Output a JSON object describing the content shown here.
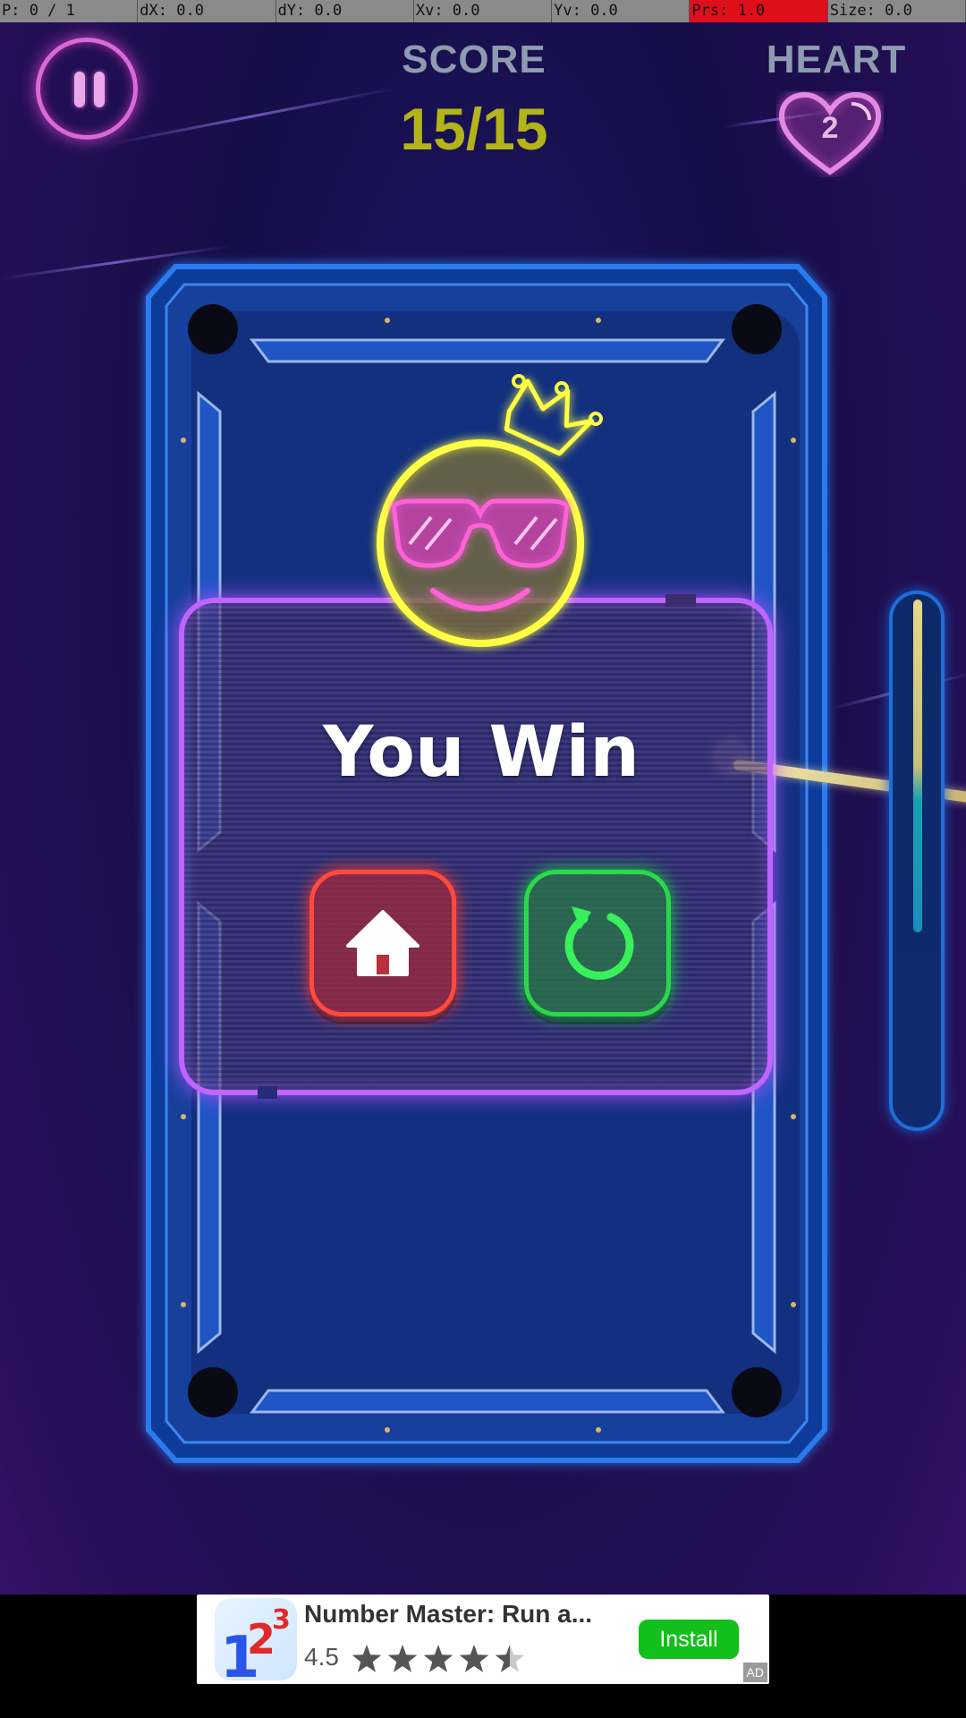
{
  "debug_bar": {
    "p": "P: 0 / 1",
    "dx": "dX: 0.0",
    "dy": "dY: 0.0",
    "xv": "Xv: 0.0",
    "yv": "Yv: 0.0",
    "prs": "Prs: 1.0",
    "size": "Size: 0.0"
  },
  "hud": {
    "score_label": "SCORE",
    "score_value": "15/15",
    "heart_label": "HEART",
    "heart_count": "2"
  },
  "win_panel": {
    "title": "You Win",
    "home_icon": "home-icon",
    "replay_icon": "replay-icon"
  },
  "power_meter": {
    "level": 0.35
  },
  "ad": {
    "title": "Number Master: Run a...",
    "rating": "4.5",
    "stars": 4.5,
    "install_label": "Install",
    "ad_label": "AD"
  },
  "colors": {
    "score": "#b3b31a",
    "panel_border": "#c065ff",
    "home_button": "#ff4a3d",
    "replay_button": "#2ad84a",
    "emoji_outline": "#ffff44",
    "sunglasses": "#ff5ad8",
    "table_rail": "#1e6fd8"
  }
}
